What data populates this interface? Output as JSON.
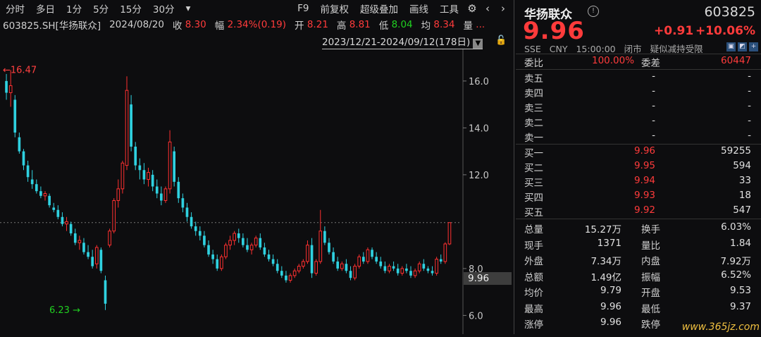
{
  "toolbar": {
    "periods": [
      "分时",
      "多日",
      "1分",
      "5分",
      "15分",
      "30分"
    ],
    "dropdown_icon": "dropdown-caret-icon",
    "items": [
      "F9",
      "前复权",
      "超级叠加",
      "画线",
      "工具"
    ],
    "icons": [
      "gear-icon",
      "chevron-left-icon",
      "chevron-right-icon"
    ]
  },
  "quote_line": {
    "symbol": "603825.SH[华扬联众]",
    "date": "2024/08/20",
    "close_label": "收",
    "close": "8.30",
    "amp_label": "幅",
    "amp": "2.34%(0.19)",
    "open_label": "开",
    "open": "8.21",
    "high_label": "高",
    "high": "8.81",
    "low_label": "低",
    "low": "8.04",
    "avg_label": "均",
    "avg": "8.34",
    "vol_label": "量",
    "vol": "..."
  },
  "range": "2023/12/21-2024/09/12(178日)",
  "chart_labels": {
    "max_label": "16.47",
    "min_label": "6.23",
    "current_price": "9.96",
    "y_ticks": [
      "16.0",
      "14.0",
      "12.0",
      "8.0",
      "6.0"
    ]
  },
  "panel": {
    "name": "华扬联众",
    "code": "603825",
    "price": "9.96",
    "change": "+0.91",
    "change_pct": "+10.06%",
    "market": "SSE",
    "currency": "CNY",
    "time": "15:00:00",
    "status": "闭市",
    "note": "疑似减持受限",
    "weibi_label": "委比",
    "weibi": "100.00%",
    "weicha_label": "委差",
    "weicha": "60447",
    "asks": [
      {
        "label": "卖五",
        "price": "-",
        "vol": "-"
      },
      {
        "label": "卖四",
        "price": "-",
        "vol": "-"
      },
      {
        "label": "卖三",
        "price": "-",
        "vol": "-"
      },
      {
        "label": "卖二",
        "price": "-",
        "vol": "-"
      },
      {
        "label": "卖一",
        "price": "-",
        "vol": "-"
      }
    ],
    "bids": [
      {
        "label": "买一",
        "price": "9.96",
        "vol": "59255"
      },
      {
        "label": "买二",
        "price": "9.95",
        "vol": "594"
      },
      {
        "label": "买三",
        "price": "9.94",
        "vol": "33"
      },
      {
        "label": "买四",
        "price": "9.93",
        "vol": "18"
      },
      {
        "label": "买五",
        "price": "9.92",
        "vol": "547"
      }
    ],
    "stats": [
      {
        "l1": "总量",
        "v1": "15.27万",
        "c1": "white",
        "l2": "换手",
        "v2": "6.03%",
        "c2": "white"
      },
      {
        "l1": "现手",
        "v1": "1371",
        "c1": "white",
        "l2": "量比",
        "v2": "1.84",
        "c2": "white"
      },
      {
        "l1": "外盘",
        "v1": "7.34万",
        "c1": "red",
        "l2": "内盘",
        "v2": "7.92万",
        "c2": "green"
      },
      {
        "l1": "总额",
        "v1": "1.49亿",
        "c1": "white",
        "l2": "振幅",
        "v2": "6.52%",
        "c2": "white"
      },
      {
        "l1": "均价",
        "v1": "9.79",
        "c1": "red",
        "l2": "开盘",
        "v2": "9.53",
        "c2": "red"
      },
      {
        "l1": "最高",
        "v1": "9.96",
        "c1": "red",
        "l2": "最低",
        "v2": "9.37",
        "c2": "red"
      },
      {
        "l1": "涨停",
        "v1": "9.96",
        "c1": "red",
        "l2": "跌停",
        "v2": "",
        "c2": "green"
      }
    ]
  },
  "watermark": "www.365jz.com",
  "candles": [
    [
      16.0,
      16.3,
      15.2,
      15.5
    ],
    [
      15.5,
      16.47,
      14.9,
      15.8
    ],
    [
      15.2,
      15.4,
      13.6,
      13.8
    ],
    [
      13.6,
      13.8,
      12.9,
      13.0
    ],
    [
      13.0,
      13.1,
      12.2,
      12.4
    ],
    [
      12.4,
      12.6,
      11.7,
      11.9
    ],
    [
      11.8,
      12.2,
      11.4,
      11.6
    ],
    [
      11.6,
      11.8,
      11.2,
      11.3
    ],
    [
      11.3,
      11.5,
      11.0,
      11.1
    ],
    [
      11.1,
      11.3,
      10.9,
      11.2
    ],
    [
      11.1,
      11.2,
      10.6,
      10.7
    ],
    [
      10.6,
      10.8,
      10.4,
      10.5
    ],
    [
      10.5,
      10.7,
      10.1,
      10.2
    ],
    [
      10.2,
      10.4,
      9.8,
      9.9
    ],
    [
      9.9,
      10.2,
      9.6,
      10.0
    ],
    [
      9.9,
      10.0,
      9.4,
      9.5
    ],
    [
      9.5,
      9.7,
      9.0,
      9.1
    ],
    [
      9.1,
      9.4,
      8.8,
      9.2
    ],
    [
      9.1,
      9.3,
      8.6,
      8.7
    ],
    [
      8.7,
      9.0,
      8.4,
      8.5
    ],
    [
      8.5,
      8.8,
      8.0,
      8.1
    ],
    [
      8.2,
      9.0,
      8.0,
      8.9
    ],
    [
      8.8,
      8.9,
      7.8,
      7.9
    ],
    [
      7.5,
      7.7,
      6.23,
      6.5
    ],
    [
      9.0,
      9.7,
      8.9,
      9.6
    ],
    [
      9.6,
      11.0,
      9.5,
      10.9
    ],
    [
      10.9,
      11.8,
      10.6,
      11.4
    ],
    [
      11.4,
      12.6,
      11.2,
      12.5
    ],
    [
      12.4,
      16.2,
      12.2,
      15.6
    ],
    [
      15.0,
      15.4,
      13.0,
      13.2
    ],
    [
      13.2,
      13.4,
      12.2,
      12.4
    ],
    [
      12.4,
      12.7,
      11.8,
      12.2
    ],
    [
      12.2,
      12.5,
      11.6,
      11.8
    ],
    [
      11.8,
      12.3,
      11.5,
      12.1
    ],
    [
      12.0,
      12.2,
      11.3,
      11.5
    ],
    [
      11.5,
      11.8,
      11.0,
      11.2
    ],
    [
      11.2,
      11.5,
      10.7,
      10.9
    ],
    [
      10.9,
      11.5,
      10.8,
      11.4
    ],
    [
      11.4,
      13.9,
      11.2,
      13.4
    ],
    [
      13.0,
      13.2,
      11.5,
      11.7
    ],
    [
      11.7,
      11.9,
      10.8,
      11.0
    ],
    [
      11.0,
      11.2,
      10.4,
      10.6
    ],
    [
      10.6,
      10.8,
      10.0,
      10.2
    ],
    [
      10.2,
      10.4,
      9.7,
      9.8
    ],
    [
      9.8,
      10.0,
      9.4,
      9.6
    ],
    [
      9.6,
      9.8,
      9.2,
      9.4
    ],
    [
      9.4,
      9.6,
      8.9,
      9.0
    ],
    [
      9.0,
      9.2,
      8.5,
      8.6
    ],
    [
      8.6,
      8.8,
      8.2,
      8.4
    ],
    [
      8.4,
      8.6,
      7.9,
      8.0
    ],
    [
      8.0,
      8.6,
      7.9,
      8.5
    ],
    [
      8.5,
      9.1,
      8.4,
      9.0
    ],
    [
      9.0,
      9.4,
      8.8,
      9.2
    ],
    [
      9.2,
      9.6,
      9.0,
      9.5
    ],
    [
      9.5,
      9.7,
      9.1,
      9.3
    ],
    [
      9.3,
      9.5,
      8.9,
      9.0
    ],
    [
      9.0,
      9.3,
      8.7,
      8.8
    ],
    [
      8.8,
      9.1,
      8.6,
      9.0
    ],
    [
      9.0,
      9.4,
      8.9,
      9.3
    ],
    [
      9.3,
      9.5,
      8.8,
      8.9
    ],
    [
      8.9,
      9.1,
      8.5,
      8.6
    ],
    [
      8.6,
      8.8,
      8.3,
      8.4
    ],
    [
      8.4,
      8.6,
      8.1,
      8.2
    ],
    [
      8.2,
      8.4,
      7.8,
      7.9
    ],
    [
      7.9,
      8.1,
      7.6,
      7.7
    ],
    [
      7.7,
      7.9,
      7.4,
      7.5
    ],
    [
      7.5,
      7.8,
      7.4,
      7.7
    ],
    [
      7.7,
      8.0,
      7.6,
      7.9
    ],
    [
      7.9,
      8.2,
      7.8,
      8.1
    ],
    [
      8.1,
      8.4,
      8.0,
      8.3
    ],
    [
      8.3,
      9.2,
      8.2,
      9.0
    ],
    [
      9.0,
      9.3,
      7.6,
      7.8
    ],
    [
      7.8,
      8.4,
      7.7,
      8.3
    ],
    [
      8.3,
      10.5,
      8.2,
      9.6
    ],
    [
      9.6,
      9.8,
      9.0,
      9.1
    ],
    [
      9.1,
      9.3,
      8.6,
      8.7
    ],
    [
      8.7,
      8.9,
      8.2,
      8.3
    ],
    [
      8.3,
      8.5,
      7.9,
      8.0
    ],
    [
      8.0,
      8.3,
      7.9,
      8.2
    ],
    [
      8.2,
      8.4,
      7.8,
      7.9
    ],
    [
      7.9,
      8.1,
      7.5,
      7.6
    ],
    [
      7.6,
      8.2,
      7.5,
      8.1
    ],
    [
      8.1,
      8.6,
      8.0,
      8.5
    ],
    [
      8.5,
      8.7,
      8.2,
      8.3
    ],
    [
      8.3,
      8.9,
      8.2,
      8.8
    ],
    [
      8.8,
      8.9,
      8.4,
      8.5
    ],
    [
      8.5,
      8.7,
      8.2,
      8.3
    ],
    [
      8.3,
      8.5,
      8.0,
      8.1
    ],
    [
      8.1,
      8.3,
      7.8,
      7.9
    ],
    [
      7.9,
      8.2,
      7.8,
      8.1
    ],
    [
      8.1,
      8.3,
      7.9,
      8.0
    ],
    [
      8.0,
      8.2,
      7.7,
      7.8
    ],
    [
      7.8,
      8.1,
      7.7,
      8.0
    ],
    [
      8.0,
      8.2,
      7.8,
      7.9
    ],
    [
      7.9,
      8.1,
      7.6,
      7.7
    ],
    [
      7.7,
      8.0,
      7.6,
      7.9
    ],
    [
      7.9,
      8.3,
      7.8,
      8.2
    ],
    [
      8.2,
      8.4,
      7.9,
      8.0
    ],
    [
      8.0,
      8.1,
      7.8,
      7.9
    ],
    [
      7.9,
      8.1,
      7.7,
      7.8
    ],
    [
      7.8,
      8.5,
      7.7,
      8.4
    ],
    [
      8.4,
      8.6,
      8.2,
      8.3
    ],
    [
      8.3,
      9.12,
      8.2,
      9.05
    ],
    [
      9.05,
      9.96,
      9.0,
      9.96
    ]
  ]
}
